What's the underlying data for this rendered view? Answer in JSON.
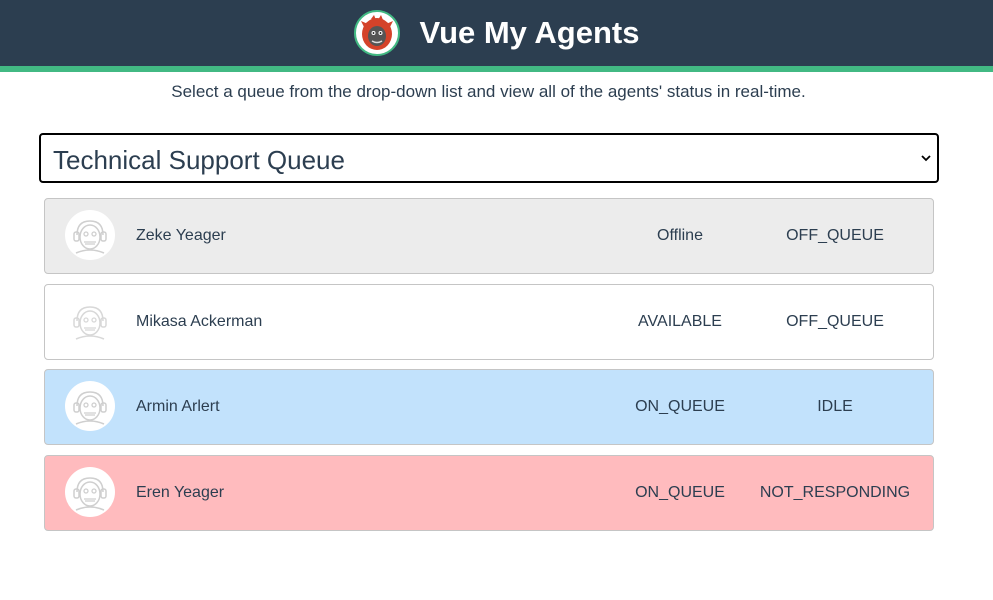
{
  "header": {
    "title": "Vue My Agents",
    "logo_icon": "orangutan-headset-logo-icon"
  },
  "subtitle": "Select a queue from the drop-down list and view all of the agents' status in real-time.",
  "queue_select": {
    "selected": "Technical Support Queue"
  },
  "colors": {
    "header_bg": "#2c3e50",
    "header_accent": "#42b983",
    "offline_bg": "#ececec",
    "available_bg": "#ffffff",
    "idle_bg": "#c2e2fc",
    "not_responding_bg": "#ffbbbe"
  },
  "agents": [
    {
      "name": "Zeke Yeager",
      "presence": "Offline",
      "routing": "OFF_QUEUE",
      "avatar_icon": "monkey-headset-avatar-icon"
    },
    {
      "name": "Mikasa Ackerman",
      "presence": "AVAILABLE",
      "routing": "OFF_QUEUE",
      "avatar_icon": "monkey-headset-avatar-icon"
    },
    {
      "name": "Armin Arlert",
      "presence": "ON_QUEUE",
      "routing": "IDLE",
      "avatar_icon": "monkey-headset-avatar-icon"
    },
    {
      "name": "Eren Yeager",
      "presence": "ON_QUEUE",
      "routing": "NOT_RESPONDING",
      "avatar_icon": "monkey-headset-avatar-icon"
    }
  ]
}
